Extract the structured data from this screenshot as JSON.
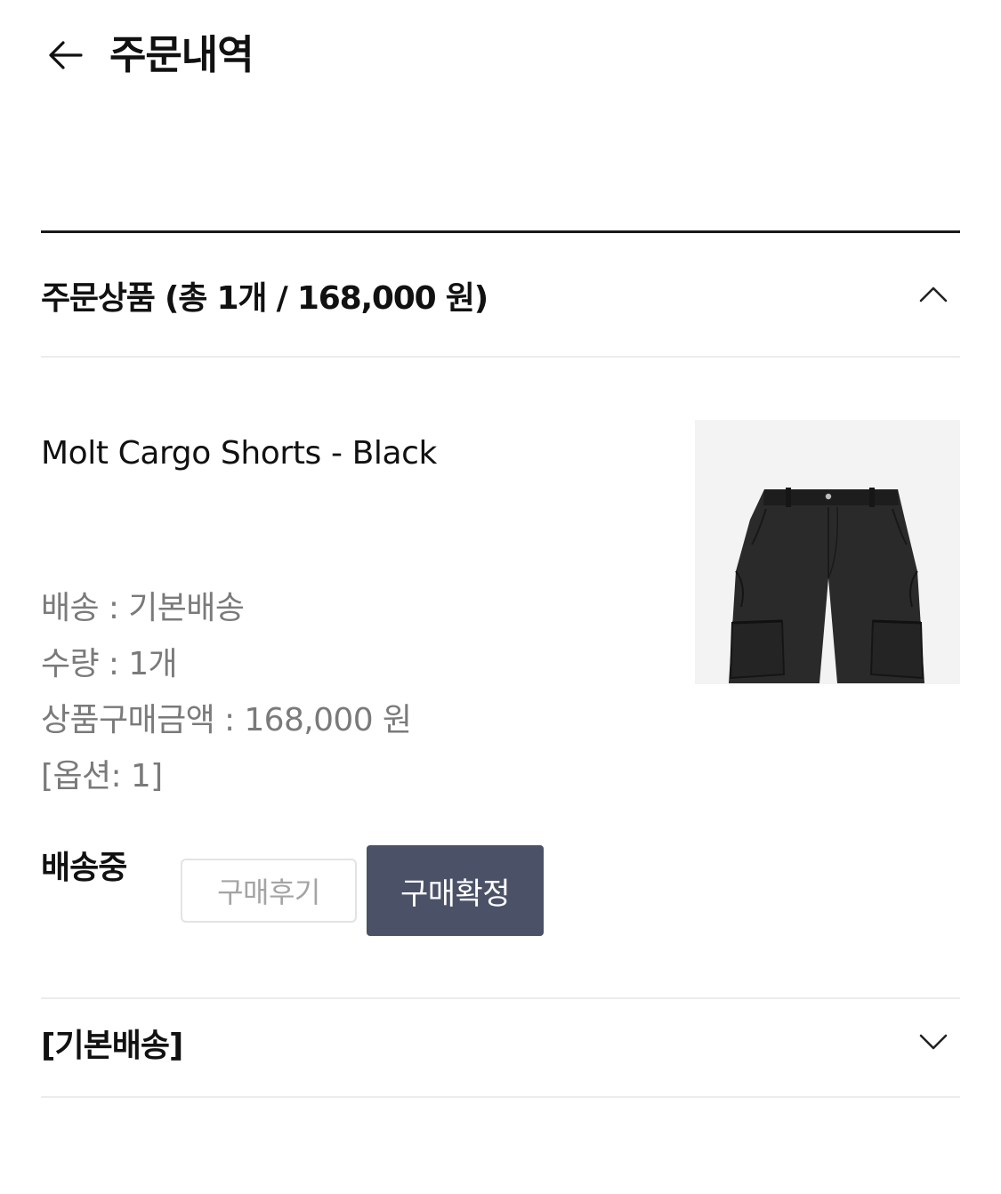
{
  "header": {
    "title": "주문내역"
  },
  "order_items_section": {
    "title": "주문상품 (총 1개 / 168,000 원)",
    "expanded": true
  },
  "product": {
    "name": "Molt Cargo Shorts - Black",
    "image_alt": "black cargo shorts",
    "info": {
      "shipping": "배송 : 기본배송",
      "quantity": "수량 : 1개",
      "price": "상품구매금액 : 168,000 원",
      "option": "[옵션: 1]"
    }
  },
  "status": {
    "label": "배송중",
    "review_button": "구매후기",
    "confirm_button": "구매확정"
  },
  "shipping_section": {
    "title": "[기본배송]",
    "expanded": false
  },
  "colors": {
    "confirm_button_bg": "#4b5166",
    "divider_dark": "#1a1a1a",
    "muted_text": "#7a7a7a"
  }
}
